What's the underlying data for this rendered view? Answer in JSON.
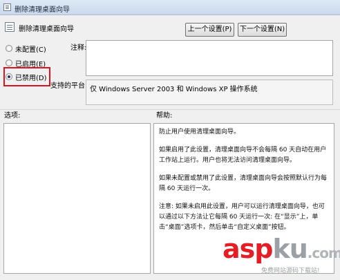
{
  "window": {
    "title": "删除清理桌面向导"
  },
  "header": {
    "title": "删除清理桌面向导",
    "prev_label": "上一个设置(P)",
    "next_label": "下一个设置(N)"
  },
  "radios": [
    {
      "label": "未配置(C)",
      "checked": false
    },
    {
      "label": "已启用(E)",
      "checked": false
    },
    {
      "label": "已禁用(D)",
      "checked": true
    }
  ],
  "comment": {
    "label": "注释:",
    "value": ""
  },
  "platform": {
    "label": "支持的平台:",
    "value": "仅 Windows Server 2003 和 Windows XP 操作系统"
  },
  "options": {
    "label": "选项:"
  },
  "help": {
    "label": "帮助:",
    "paragraphs": [
      "防止用户使用清理桌面向导。",
      "如果启用了此设置，清理桌面向导不会每隔 60 天自动在用户工作站上运行。用户也将无法访问清理桌面向导。",
      "如果未配置或禁用了此设置，清理桌面向导会按照默认行为每隔 60 天运行一次。",
      "注意: 如果未启用此设置，用户可以运行清理桌面向导，也可以通过以下方法让它每隔 60 天运行一次: 在“显示”上，单击“桌面”选项卡，然后单击“自定义桌面”按钮。"
    ]
  },
  "watermark": {
    "part_a": "asp",
    "part_b": "ku",
    "part_c": ".com",
    "subtitle": "免费网站源码下载站!"
  },
  "colors": {
    "highlight": "#d9141d",
    "watermark_red": "#e41e24"
  }
}
